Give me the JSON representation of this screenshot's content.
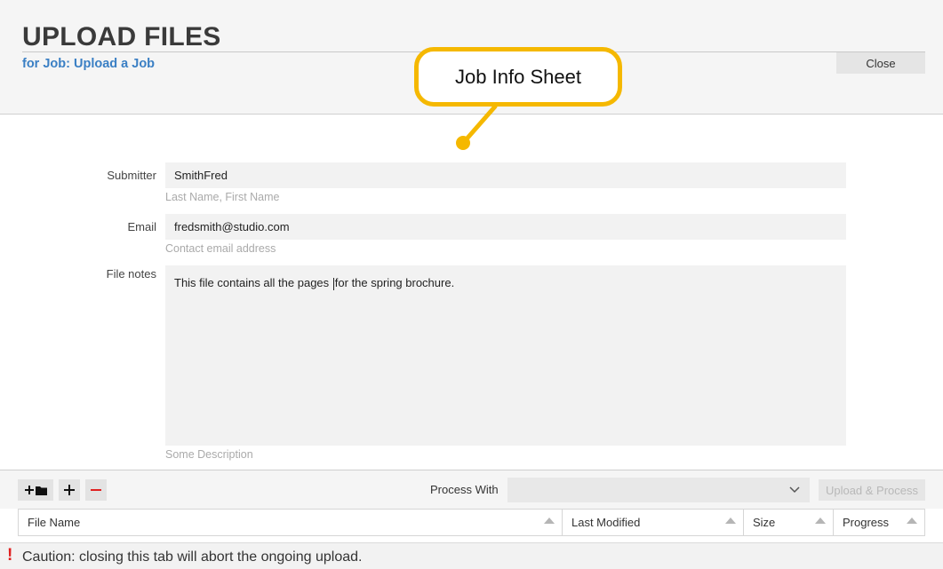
{
  "header": {
    "title": "UPLOAD FILES",
    "subtitle": "for Job: Upload a Job",
    "close_label": "Close"
  },
  "callout": {
    "text": "Job Info Sheet",
    "color": "#f5b800"
  },
  "form": {
    "submitter": {
      "label": "Submitter",
      "value": "SmithFred",
      "hint": "Last Name, First Name"
    },
    "email": {
      "label": "Email",
      "value": "fredsmith@studio.com",
      "hint": "Contact email address"
    },
    "notes": {
      "label": "File notes",
      "value_before_caret": "This file contains all the pages ",
      "value_after_caret": "for the spring brochure.",
      "hint": "Some Description"
    }
  },
  "toolbar": {
    "add_folder_icon": "plus-folder-icon",
    "add_icon": "plus-icon",
    "remove_icon": "minus-icon",
    "process_with_label": "Process With",
    "process_with_value": "",
    "upload_label": "Upload & Process"
  },
  "table": {
    "columns": [
      "File Name",
      "Last Modified",
      "Size",
      "Progress"
    ]
  },
  "footer": {
    "caution": "Caution: closing this tab will abort the ongoing upload.",
    "warning_glyph": "!",
    "warning_color": "#e02020"
  },
  "colors": {
    "accent": "#3a7fc4",
    "remove": "#e02020"
  }
}
